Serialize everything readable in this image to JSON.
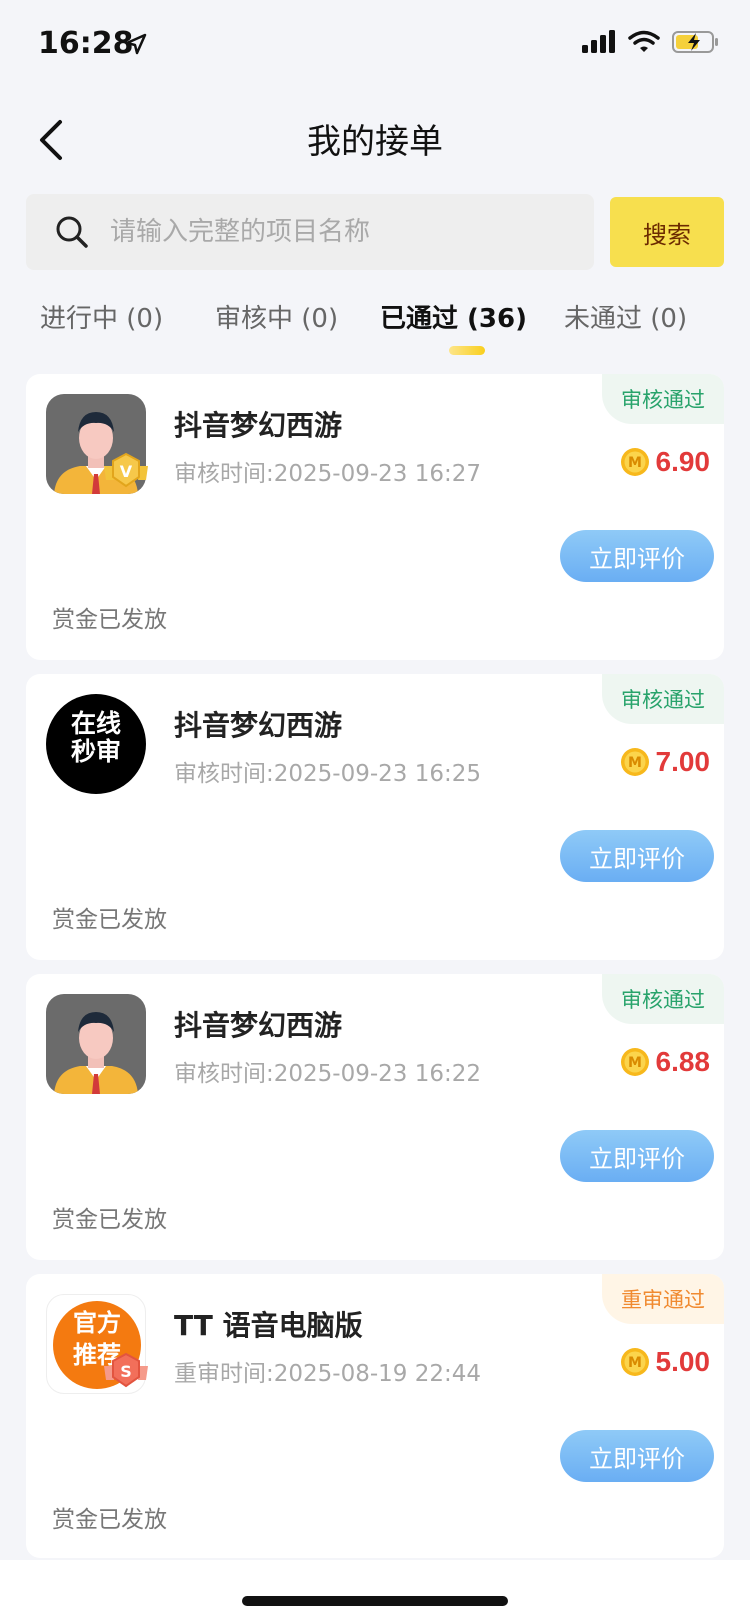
{
  "status_bar": {
    "time": "16:28"
  },
  "nav": {
    "title": "我的接单"
  },
  "search": {
    "placeholder": "请输入完整的项目名称",
    "button": "搜索"
  },
  "tabs": [
    {
      "label": "进行中 (0)"
    },
    {
      "label": "审核中 (0)"
    },
    {
      "label": "已通过 (36)",
      "active": true
    },
    {
      "label": "未通过 (0)"
    }
  ],
  "orders": [
    {
      "title": "抖音梦幻西游",
      "time": "审核时间:2025-09-23 16:27",
      "status": "审核通过",
      "amount": "6.90",
      "button": "立即评价",
      "note": "赏金已发放",
      "avatar": "person-vip"
    },
    {
      "title": "抖音梦幻西游",
      "time": "审核时间:2025-09-23 16:25",
      "status": "审核通过",
      "amount": "7.00",
      "button": "立即评价",
      "note": "赏金已发放",
      "avatar": "online-review",
      "avatar_text": [
        "在线",
        "秒审"
      ]
    },
    {
      "title": "抖音梦幻西游",
      "time": "审核时间:2025-09-23 16:22",
      "status": "审核通过",
      "amount": "6.88",
      "button": "立即评价",
      "note": "赏金已发放",
      "avatar": "person"
    },
    {
      "title": "TT 语音电脑版",
      "time": "重审时间:2025-08-19 22:44",
      "status": "重审通过",
      "amount": "5.00",
      "button": "立即评价",
      "note": "赏金已发放",
      "avatar": "official-recommend",
      "avatar_text": [
        "官方",
        "推荐"
      ]
    }
  ],
  "colors": {
    "accent_yellow": "#f7df4e",
    "approved_green": "#28a36b",
    "re_approved_orange": "#f08a30",
    "amount_red": "#e23a3a",
    "button_blue": "#6aaef3"
  }
}
